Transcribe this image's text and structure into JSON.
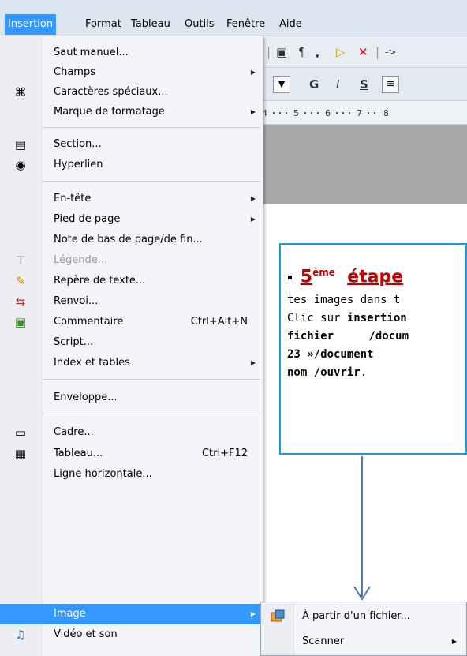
{
  "menubar": {
    "items": [
      "Insertion",
      "Format",
      "Tableau",
      "Outils",
      "Fenêtre",
      "Aide"
    ],
    "active_index": 0
  },
  "menu": {
    "items": [
      {
        "label": "Saut manuel...",
        "icon": ""
      },
      {
        "label": "Champs",
        "icon": "",
        "submenu": true
      },
      {
        "label": "Caractères spéciaux...",
        "icon": "special-chars-icon"
      },
      {
        "label": "Marque de formatage",
        "icon": "",
        "submenu": true
      },
      {
        "label": "Section...",
        "icon": "section-icon"
      },
      {
        "label": "Hyperlien",
        "icon": "hyperlink-icon"
      },
      {
        "label": "En-tête",
        "icon": "",
        "submenu": true
      },
      {
        "label": "Pied de page",
        "icon": "",
        "submenu": true
      },
      {
        "label": "Note de bas de page/de fin...",
        "icon": ""
      },
      {
        "label": "Légende...",
        "icon": "caption-icon",
        "disabled": true
      },
      {
        "label": "Repère de texte...",
        "icon": "bookmark-icon"
      },
      {
        "label": "Renvoi...",
        "icon": "cross-reference-icon"
      },
      {
        "label": "Commentaire",
        "icon": "comment-icon",
        "shortcut": "Ctrl+Alt+N"
      },
      {
        "label": "Script...",
        "icon": ""
      },
      {
        "label": "Index et tables",
        "icon": "",
        "submenu": true
      },
      {
        "label": "Enveloppe...",
        "icon": ""
      },
      {
        "label": "Cadre...",
        "icon": "frame-icon"
      },
      {
        "label": "Tableau...",
        "icon": "table-icon",
        "shortcut": "Ctrl+F12"
      },
      {
        "label": "Ligne horizontale...",
        "icon": ""
      },
      {
        "label": "Image",
        "icon": "",
        "submenu": true,
        "highlighted": true
      },
      {
        "label": "Vidéo et son",
        "icon": "video-sound-icon"
      }
    ]
  },
  "submenu": {
    "items": [
      {
        "label": "À partir d'un fichier...",
        "icon": "image-from-file-icon"
      },
      {
        "label": "Scanner",
        "submenu": true
      }
    ]
  },
  "toolbar": {
    "bold_label": "G",
    "italic_label": "I",
    "underline_label": "S",
    "arrow_label": "->"
  },
  "ruler": {
    "ticks": [
      "4",
      "5",
      "6",
      "7",
      "8"
    ]
  },
  "note": {
    "bullet": "▪",
    "title_num": "5",
    "title_sup": "ème",
    "title_word": "étape",
    "line1": "tes images dans t",
    "line2_a": "Clic sur ",
    "line2_b": "insertion",
    "line3_a": "fichier",
    "line3_b": " /docum",
    "line4": "23 »/document",
    "line5_a": "nom /ouvrir",
    "line5_b": "."
  },
  "colors": {
    "accent": "#3399ff",
    "note_border": "#1e9ae0",
    "note_title": "#c00000",
    "arrow": "#4a79b8"
  }
}
